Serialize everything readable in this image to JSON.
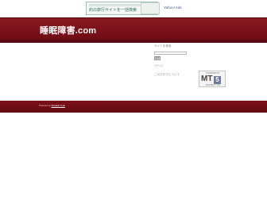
{
  "ad": {
    "banner_text": "約の旅行サイトを一括検索",
    "logo_text": "Yahoo! Ads"
  },
  "site": {
    "title": "睡眠障害.com"
  },
  "sidebar": {
    "search_heading": "サイトを検索",
    "search_button": "検索",
    "section_heading": "ページ",
    "powered_heading": "このブログについて"
  },
  "mt_badge": {
    "top": "POWERED BY",
    "mark": "MT",
    "version": "5",
    "bottom": "MOVABLE TYPE"
  },
  "footer": {
    "prefix": "Powered by",
    "link": "Movable Type"
  },
  "colors": {
    "header": "#7a1119",
    "footer": "#6b0d14"
  }
}
